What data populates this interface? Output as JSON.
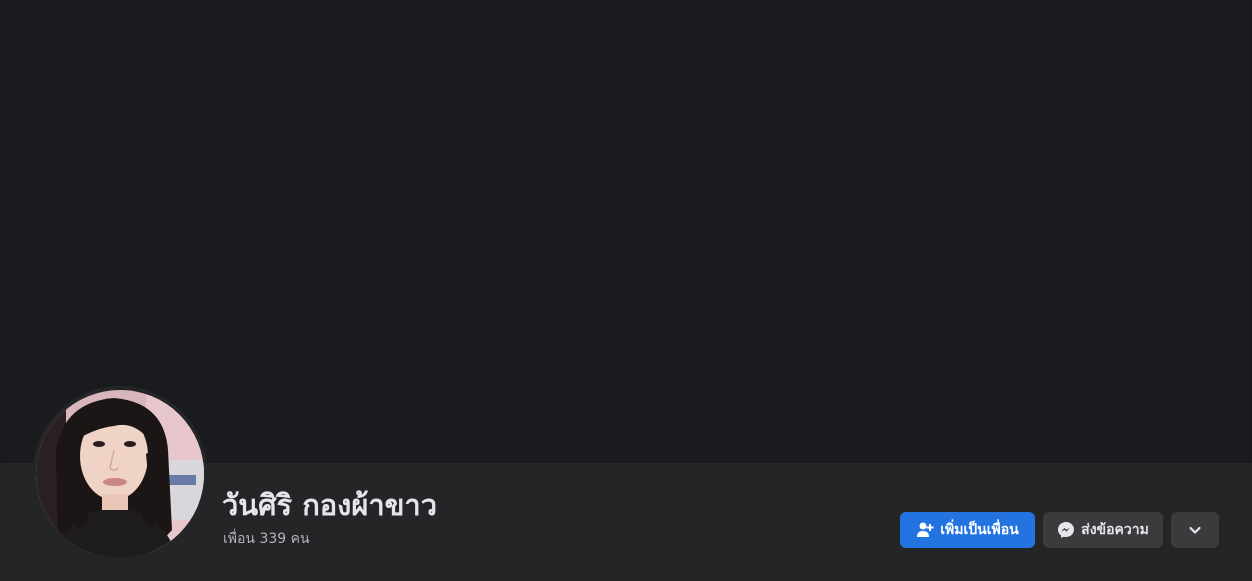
{
  "profile": {
    "name": "วันศิริ กองผ้าขาว",
    "friends_text": "เพื่อน 339 คน"
  },
  "actions": {
    "add_friend_label": "เพิ่มเป็นเพื่อน",
    "message_label": "ส่งข้อความ",
    "more_icon": "chevron-down-icon"
  },
  "colors": {
    "background": "#18191a",
    "cover": "#1a1b1e",
    "header": "#242526",
    "primary_button": "#2374e1",
    "secondary_button": "#3a3b3c",
    "text_primary": "#e4e6eb",
    "text_secondary": "#b0b3b8"
  }
}
